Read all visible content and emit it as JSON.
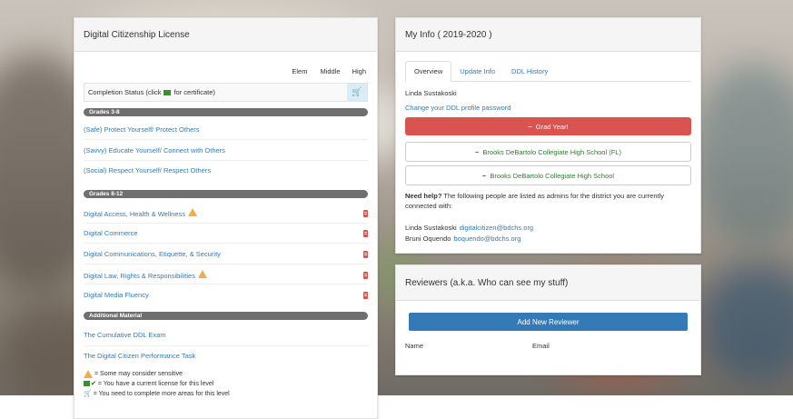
{
  "license_panel": {
    "title": "Digital Citizenship License",
    "levels": [
      "Elem",
      "Middle",
      "High"
    ],
    "completion_status": "Completion Status (click",
    "completion_status_suffix": "for certificate)",
    "sections": [
      {
        "label": "Grades 3-8",
        "items": [
          {
            "label": "(Safe) Protect Yourself/ Protect Others"
          },
          {
            "label": "(Savvy) Educate Yourself/ Connect with Others"
          },
          {
            "label": "(Social) Respect Yourself/ Respect Others"
          }
        ]
      },
      {
        "label": "Grades 8-12",
        "items": [
          {
            "label": "Digital Access, Health & Wellness",
            "warning": true
          },
          {
            "label": "Digital Commerce"
          },
          {
            "label": "Digital Communications, Etiquette, & Security"
          },
          {
            "label": "Digital Law, Rights & Responsibilities",
            "warning": true
          },
          {
            "label": "Digital Media Fluency"
          }
        ]
      },
      {
        "label": "Additional Material",
        "items": [
          {
            "label": "The Cumulative DDL Exam"
          },
          {
            "label": "The Digital Citizen Performance Task"
          }
        ]
      }
    ],
    "legend": [
      "= Some may consider sensitive",
      "= You have a current license for this level",
      "= You need to complete more areas for this level"
    ]
  },
  "info_panel": {
    "title": "My Info ( 2019-2020 )",
    "tabs": [
      "Overview",
      "Update Info",
      "DDL History"
    ],
    "name": "Linda Sustakoski",
    "change_password": "Change your DDL profile password",
    "grad_year": "Grad Year!",
    "schools": [
      "Brooks DeBartolo Collegiate High School (FL)",
      "Brooks DeBartolo Collegiate High School"
    ],
    "help_bold": "Need help?",
    "help_text": "The following people are listed as admins for the district you are currently connected with:",
    "admins": [
      {
        "name": "Linda Sustakoski",
        "email": "digitalcitizen@bdchs.org"
      },
      {
        "name": "Bruni Oquendo",
        "email": "boquendo@bdchs.org"
      }
    ]
  },
  "reviewers_panel": {
    "title": "Reviewers (a.k.a. Who can see my stuff)",
    "add_button": "Add New Reviewer",
    "col_name": "Name",
    "col_email": "Email"
  }
}
